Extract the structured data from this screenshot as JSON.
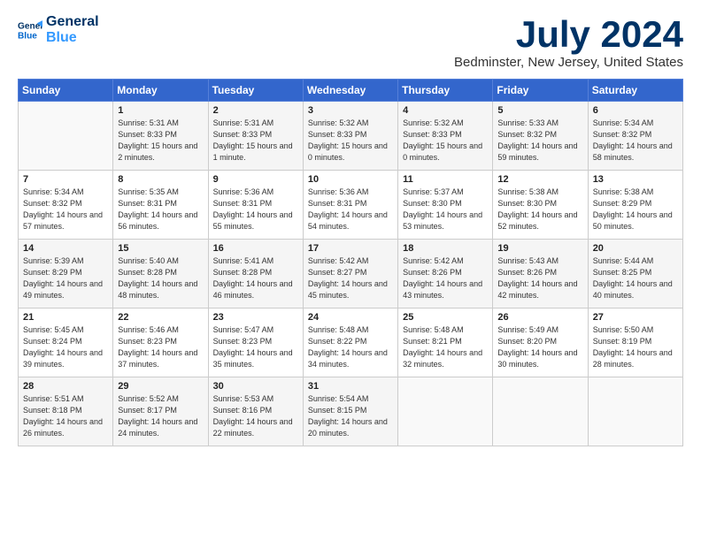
{
  "logo": {
    "line1": "General",
    "line2": "Blue"
  },
  "title": "July 2024",
  "subtitle": "Bedminster, New Jersey, United States",
  "days_of_week": [
    "Sunday",
    "Monday",
    "Tuesday",
    "Wednesday",
    "Thursday",
    "Friday",
    "Saturday"
  ],
  "weeks": [
    [
      {
        "day": "",
        "sunrise": "",
        "sunset": "",
        "daylight": ""
      },
      {
        "day": "1",
        "sunrise": "Sunrise: 5:31 AM",
        "sunset": "Sunset: 8:33 PM",
        "daylight": "Daylight: 15 hours and 2 minutes."
      },
      {
        "day": "2",
        "sunrise": "Sunrise: 5:31 AM",
        "sunset": "Sunset: 8:33 PM",
        "daylight": "Daylight: 15 hours and 1 minute."
      },
      {
        "day": "3",
        "sunrise": "Sunrise: 5:32 AM",
        "sunset": "Sunset: 8:33 PM",
        "daylight": "Daylight: 15 hours and 0 minutes."
      },
      {
        "day": "4",
        "sunrise": "Sunrise: 5:32 AM",
        "sunset": "Sunset: 8:33 PM",
        "daylight": "Daylight: 15 hours and 0 minutes."
      },
      {
        "day": "5",
        "sunrise": "Sunrise: 5:33 AM",
        "sunset": "Sunset: 8:32 PM",
        "daylight": "Daylight: 14 hours and 59 minutes."
      },
      {
        "day": "6",
        "sunrise": "Sunrise: 5:34 AM",
        "sunset": "Sunset: 8:32 PM",
        "daylight": "Daylight: 14 hours and 58 minutes."
      }
    ],
    [
      {
        "day": "7",
        "sunrise": "Sunrise: 5:34 AM",
        "sunset": "Sunset: 8:32 PM",
        "daylight": "Daylight: 14 hours and 57 minutes."
      },
      {
        "day": "8",
        "sunrise": "Sunrise: 5:35 AM",
        "sunset": "Sunset: 8:31 PM",
        "daylight": "Daylight: 14 hours and 56 minutes."
      },
      {
        "day": "9",
        "sunrise": "Sunrise: 5:36 AM",
        "sunset": "Sunset: 8:31 PM",
        "daylight": "Daylight: 14 hours and 55 minutes."
      },
      {
        "day": "10",
        "sunrise": "Sunrise: 5:36 AM",
        "sunset": "Sunset: 8:31 PM",
        "daylight": "Daylight: 14 hours and 54 minutes."
      },
      {
        "day": "11",
        "sunrise": "Sunrise: 5:37 AM",
        "sunset": "Sunset: 8:30 PM",
        "daylight": "Daylight: 14 hours and 53 minutes."
      },
      {
        "day": "12",
        "sunrise": "Sunrise: 5:38 AM",
        "sunset": "Sunset: 8:30 PM",
        "daylight": "Daylight: 14 hours and 52 minutes."
      },
      {
        "day": "13",
        "sunrise": "Sunrise: 5:38 AM",
        "sunset": "Sunset: 8:29 PM",
        "daylight": "Daylight: 14 hours and 50 minutes."
      }
    ],
    [
      {
        "day": "14",
        "sunrise": "Sunrise: 5:39 AM",
        "sunset": "Sunset: 8:29 PM",
        "daylight": "Daylight: 14 hours and 49 minutes."
      },
      {
        "day": "15",
        "sunrise": "Sunrise: 5:40 AM",
        "sunset": "Sunset: 8:28 PM",
        "daylight": "Daylight: 14 hours and 48 minutes."
      },
      {
        "day": "16",
        "sunrise": "Sunrise: 5:41 AM",
        "sunset": "Sunset: 8:28 PM",
        "daylight": "Daylight: 14 hours and 46 minutes."
      },
      {
        "day": "17",
        "sunrise": "Sunrise: 5:42 AM",
        "sunset": "Sunset: 8:27 PM",
        "daylight": "Daylight: 14 hours and 45 minutes."
      },
      {
        "day": "18",
        "sunrise": "Sunrise: 5:42 AM",
        "sunset": "Sunset: 8:26 PM",
        "daylight": "Daylight: 14 hours and 43 minutes."
      },
      {
        "day": "19",
        "sunrise": "Sunrise: 5:43 AM",
        "sunset": "Sunset: 8:26 PM",
        "daylight": "Daylight: 14 hours and 42 minutes."
      },
      {
        "day": "20",
        "sunrise": "Sunrise: 5:44 AM",
        "sunset": "Sunset: 8:25 PM",
        "daylight": "Daylight: 14 hours and 40 minutes."
      }
    ],
    [
      {
        "day": "21",
        "sunrise": "Sunrise: 5:45 AM",
        "sunset": "Sunset: 8:24 PM",
        "daylight": "Daylight: 14 hours and 39 minutes."
      },
      {
        "day": "22",
        "sunrise": "Sunrise: 5:46 AM",
        "sunset": "Sunset: 8:23 PM",
        "daylight": "Daylight: 14 hours and 37 minutes."
      },
      {
        "day": "23",
        "sunrise": "Sunrise: 5:47 AM",
        "sunset": "Sunset: 8:23 PM",
        "daylight": "Daylight: 14 hours and 35 minutes."
      },
      {
        "day": "24",
        "sunrise": "Sunrise: 5:48 AM",
        "sunset": "Sunset: 8:22 PM",
        "daylight": "Daylight: 14 hours and 34 minutes."
      },
      {
        "day": "25",
        "sunrise": "Sunrise: 5:48 AM",
        "sunset": "Sunset: 8:21 PM",
        "daylight": "Daylight: 14 hours and 32 minutes."
      },
      {
        "day": "26",
        "sunrise": "Sunrise: 5:49 AM",
        "sunset": "Sunset: 8:20 PM",
        "daylight": "Daylight: 14 hours and 30 minutes."
      },
      {
        "day": "27",
        "sunrise": "Sunrise: 5:50 AM",
        "sunset": "Sunset: 8:19 PM",
        "daylight": "Daylight: 14 hours and 28 minutes."
      }
    ],
    [
      {
        "day": "28",
        "sunrise": "Sunrise: 5:51 AM",
        "sunset": "Sunset: 8:18 PM",
        "daylight": "Daylight: 14 hours and 26 minutes."
      },
      {
        "day": "29",
        "sunrise": "Sunrise: 5:52 AM",
        "sunset": "Sunset: 8:17 PM",
        "daylight": "Daylight: 14 hours and 24 minutes."
      },
      {
        "day": "30",
        "sunrise": "Sunrise: 5:53 AM",
        "sunset": "Sunset: 8:16 PM",
        "daylight": "Daylight: 14 hours and 22 minutes."
      },
      {
        "day": "31",
        "sunrise": "Sunrise: 5:54 AM",
        "sunset": "Sunset: 8:15 PM",
        "daylight": "Daylight: 14 hours and 20 minutes."
      },
      {
        "day": "",
        "sunrise": "",
        "sunset": "",
        "daylight": ""
      },
      {
        "day": "",
        "sunrise": "",
        "sunset": "",
        "daylight": ""
      },
      {
        "day": "",
        "sunrise": "",
        "sunset": "",
        "daylight": ""
      }
    ]
  ]
}
